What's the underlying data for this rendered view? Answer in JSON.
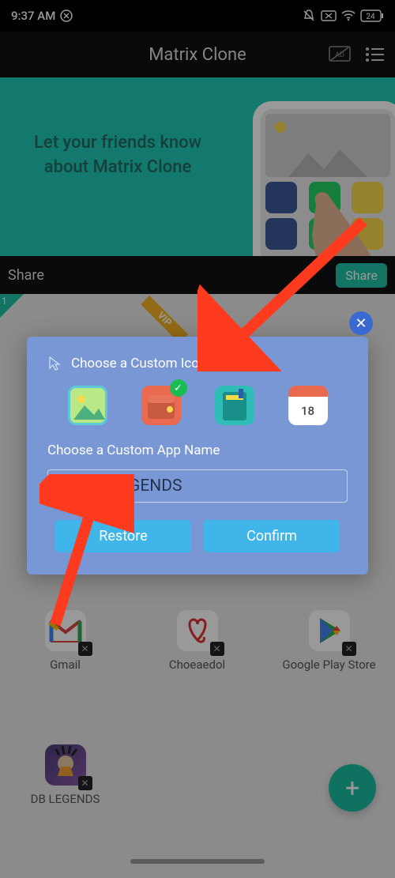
{
  "status": {
    "time": "9:37 AM",
    "battery": "24"
  },
  "header": {
    "title": "Matrix Clone"
  },
  "banner": {
    "text_line1": "Let your friends know",
    "text_line2": "about Matrix Clone"
  },
  "share": {
    "label": "Share",
    "button": "Share"
  },
  "corner_badge": "1",
  "apps": {
    "gmail": "Gmail",
    "choeaedol": "Choeaedol",
    "playstore": "Google Play Store",
    "dblegends": "DB LEGENDS"
  },
  "dialog": {
    "title": "Choose a Custom Icon",
    "subtitle": "Choose a Custom App Name",
    "input_value": "NewDBLEGENDS",
    "calendar_day": "18",
    "restore": "Restore",
    "confirm": "Confirm"
  }
}
